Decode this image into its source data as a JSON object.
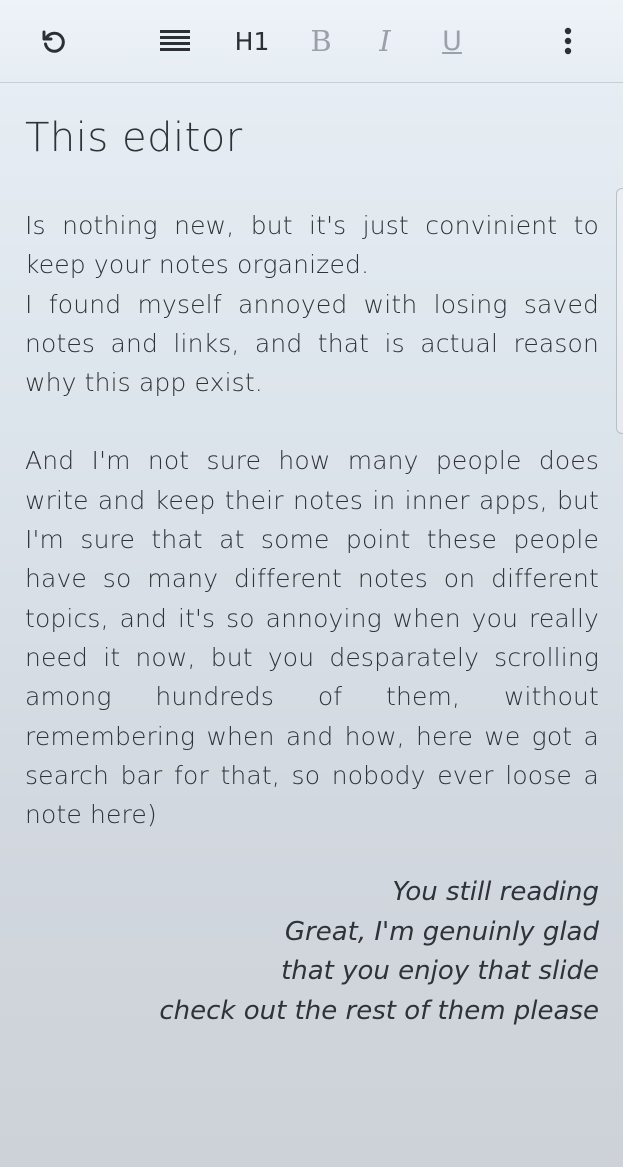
{
  "toolbar": {
    "undo_icon": "undo-icon",
    "align_icon": "align-justify-icon",
    "heading_label": "H1",
    "bold_label": "B",
    "italic_label": "I",
    "underline_label": "U",
    "more_icon": "more-vertical-icon"
  },
  "editor": {
    "title": "This editor",
    "paragraph1": "Is nothing new, but it's just convinient to keep your notes organized.\nI found myself annoyed with losing saved notes and links, and that is actual reason why this app exist.",
    "paragraph2": "And I'm not sure how many people does write and keep their notes in inner apps, but I'm sure that at some point these people have so many different notes on different topics, and it's so annoying when you really need it now, but you desparately scrolling among hundreds of them, without remembering when and how, here we got a search bar for that, so nobody ever loose a note here)",
    "closing_lines": [
      "You still reading",
      "Great, I'm genuinly glad",
      "that you enjoy that slide",
      "check out the rest of them please"
    ]
  },
  "colors": {
    "text": "#2f3338",
    "disabled_format": "#9aa1a8",
    "toolbar_bg": "#eaf0f6"
  }
}
